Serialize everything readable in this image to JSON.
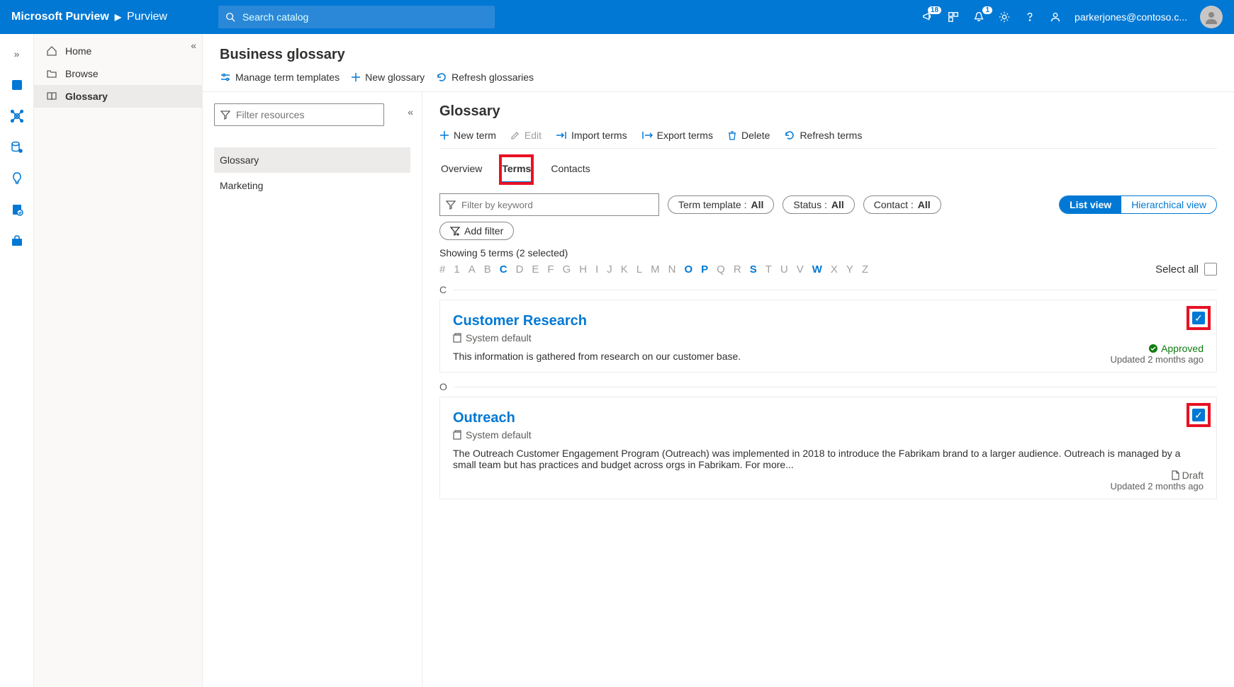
{
  "header": {
    "brand": "Microsoft Purview",
    "breadcrumb": "Purview",
    "search_placeholder": "Search catalog",
    "badge_megaphone": "18",
    "badge_bell": "1",
    "user_email": "parkerjones@contoso.c..."
  },
  "nav": {
    "items": [
      "Home",
      "Browse",
      "Glossary"
    ],
    "active": 2
  },
  "page": {
    "title": "Business glossary",
    "toolbar": {
      "manage": "Manage term templates",
      "new_glossary": "New glossary",
      "refresh": "Refresh glossaries"
    }
  },
  "resources": {
    "filter_placeholder": "Filter resources",
    "items": [
      "Glossary",
      "Marketing"
    ],
    "active": 0
  },
  "detail": {
    "title": "Glossary",
    "toolbar": {
      "new_term": "New term",
      "edit": "Edit",
      "import": "Import terms",
      "export": "Export terms",
      "delete": "Delete",
      "refresh": "Refresh terms"
    },
    "tabs": [
      "Overview",
      "Terms",
      "Contacts"
    ],
    "active_tab": 1,
    "filters": {
      "keyword_placeholder": "Filter by keyword",
      "term_template_label": "Term template : ",
      "term_template_value": "All",
      "status_label": "Status : ",
      "status_value": "All",
      "contact_label": "Contact : ",
      "contact_value": "All",
      "add_filter": "Add filter"
    },
    "view_toggle": {
      "list": "List view",
      "hier": "Hierarchical view"
    },
    "showing": "Showing 5 terms (2 selected)",
    "alpha_enabled": [
      "C",
      "O",
      "P",
      "S",
      "W"
    ],
    "select_all": "Select all"
  },
  "terms": [
    {
      "letter": "C",
      "title": "Customer Research",
      "template": "System default",
      "desc": "This information is gathered from research on our customer base.",
      "status": "Approved",
      "updated": "Updated 2 months ago",
      "checked": true
    },
    {
      "letter": "O",
      "title": "Outreach",
      "template": "System default",
      "desc": "The Outreach Customer Engagement Program (Outreach) was implemented in 2018 to introduce the Fabrikam brand to a larger audience. Outreach is managed by a small team but has practices and budget across orgs in Fabrikam. For more...",
      "status": "Draft",
      "updated": "Updated 2 months ago",
      "checked": true
    }
  ]
}
